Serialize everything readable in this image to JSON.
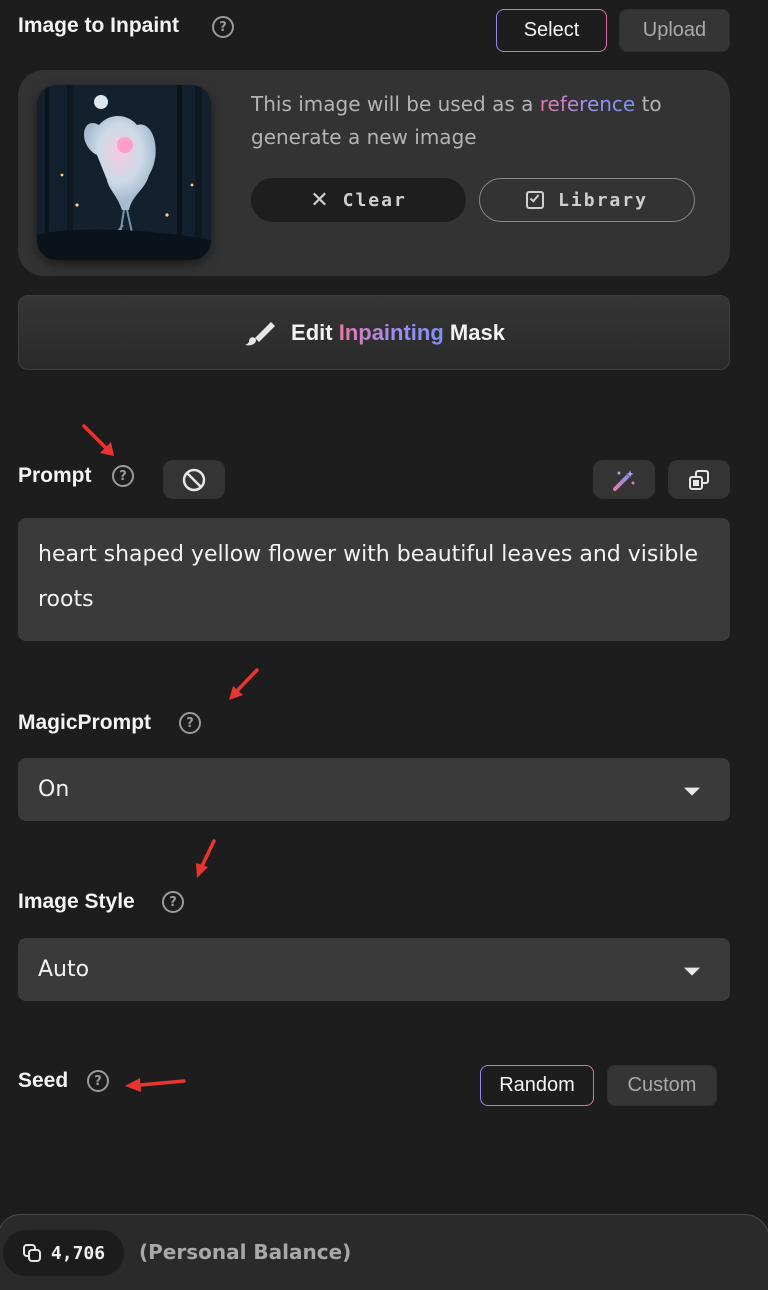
{
  "image_section": {
    "label": "Image to Inpaint",
    "help": "?",
    "select_label": "Select",
    "upload_label": "Upload",
    "description_pre": "This image will be used as a",
    "description_link": "reference",
    "description_post": "to generate a new image",
    "clear_label": "Clear",
    "library_label": "Library",
    "edit_mask": {
      "part1": "Edit",
      "part2": "Inpainting",
      "part3": "Mask"
    }
  },
  "prompt": {
    "label": "Prompt",
    "help": "?",
    "text": "heart shaped yellow flower with beautiful leaves and visible roots"
  },
  "magic_prompt": {
    "label": "MagicPrompt",
    "help": "?",
    "value": "On"
  },
  "image_style": {
    "label": "Image Style",
    "help": "?",
    "value": "Auto"
  },
  "seed": {
    "label": "Seed",
    "help": "?",
    "random_label": "Random",
    "custom_label": "Custom"
  },
  "footer": {
    "balance": "4,706",
    "balance_label": "(Personal Balance)"
  },
  "colors": {
    "background": "#1d1d1d",
    "card": "#333333",
    "annotation_arrow": "#e8352f",
    "accent_pink": "#e878a8",
    "accent_blue": "#8e8cf0"
  }
}
